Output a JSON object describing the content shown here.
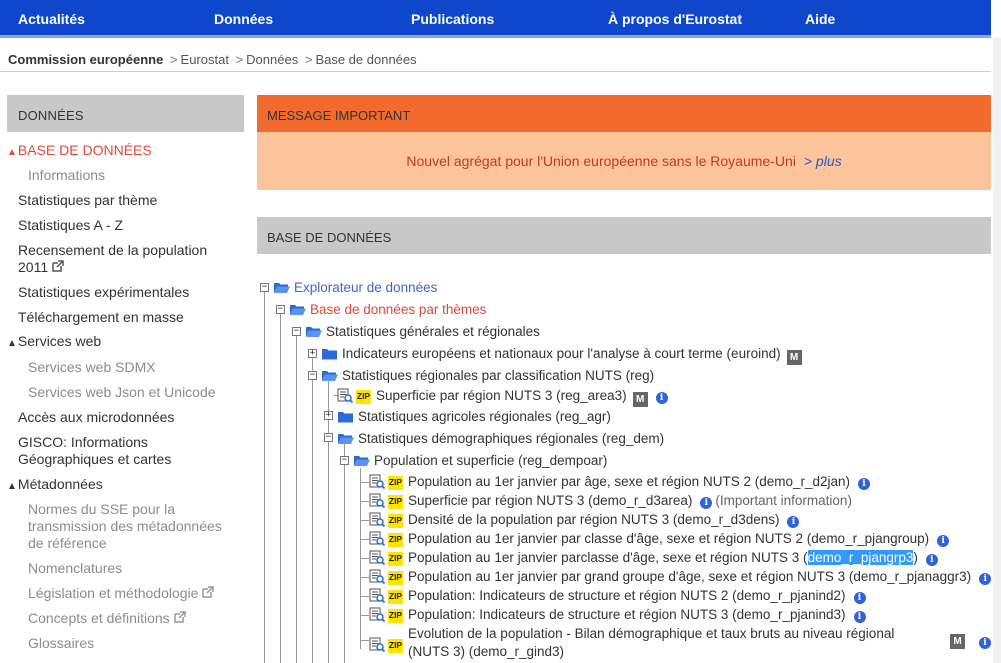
{
  "nav": {
    "items": [
      "Actualités",
      "Données",
      "Publications",
      "À propos d'Eurostat",
      "Aide"
    ]
  },
  "breadcrumb": {
    "home": "Commission européenne",
    "items": [
      "Eurostat",
      "Données",
      "Base de données"
    ]
  },
  "sidebar": {
    "title": "DONNÉES",
    "items": {
      "base": "BASE DE DONNÉES",
      "informations": "Informations",
      "stat_theme": "Statistiques par thème",
      "stat_az": "Statistiques A - Z",
      "recensement_1": "Recensement de la population",
      "recensement_2": "2011",
      "experimentales": "Statistiques expérimentales",
      "telechargement": "Téléchargement en masse",
      "services_web": "Services web",
      "sdmx": "Services web SDMX",
      "json": "Services web Json et Unicode",
      "microdonnees": "Accès aux microdonnées",
      "gisco_1": "GISCO: Informations",
      "gisco_2": "Géographiques et cartes",
      "metadonnees": "Métadonnées",
      "normes_1": "Normes du SSE pour la",
      "normes_2": "transmission des métadonnées",
      "normes_3": "de référence",
      "nomenclatures": "Nomenclatures",
      "legislation": "Législation et méthodologie",
      "concepts": "Concepts et définitions",
      "glossaires": "Glossaires"
    }
  },
  "message": {
    "header": "MESSAGE IMPORTANT",
    "text": "Nouvel agrégat pour l'Union européenne sans le Royaume-Uni",
    "more": "> plus"
  },
  "database": {
    "header": "BASE DE DONNÉES",
    "tree": {
      "explorer": "Explorateur de données",
      "by_theme": "Base de données par thèmes",
      "general": "Statistiques générales et régionales",
      "euroind": "Indicateurs européens et nationaux pour l'analyse à court terme (euroind)",
      "reg": "Statistiques régionales par classification NUTS (reg)",
      "reg_area3": "Superficie par région NUTS 3 (reg_area3)",
      "reg_agr": "Statistiques agricoles régionales (reg_agr)",
      "reg_dem": "Statistiques démographiques régionales (reg_dem)",
      "reg_dempoar": "Population et superficie (reg_dempoar)",
      "d2jan": "Population au 1er janvier par âge, sexe et région NUTS 2 (demo_r_d2jan)",
      "d3area": "Superficie par région NUTS 3 (demo_r_d3area)",
      "d3area_note": "(Important information)",
      "d3dens": "Densité de la population par région NUTS 3 (demo_r_d3dens)",
      "pjangroup": "Population au 1er janvier par classe d'âge, sexe et région NUTS 2 (demo_r_pjangroup)",
      "pjangrp3_pre": "Population au 1er janvier parclasse d'âge, sexe et région NUTS 3 (",
      "pjangrp3_hl": "demo_r_pjangrp3",
      "pjangrp3_post": ")",
      "pjanaggr3": "Population au 1er janvier par grand groupe d'âge, sexe et région NUTS 3 (demo_r_pjanaggr3)",
      "pjanind2": "Population: Indicateurs de structure et région NUTS 2 (demo_r_pjanind2)",
      "pjanind3": "Population: Indicateurs de structure et région NUTS 3 (demo_r_pjanind3)",
      "gind3_1": "Evolution de la population - Bilan démographique et taux bruts au niveau régional",
      "gind3_2": "(NUTS 3) (demo_r_gind3)"
    },
    "zip_label": "ZIP",
    "m_label": "M",
    "info_label": "i"
  },
  "colors": {
    "nav_bg": "#0e47cb",
    "accent_red": "#e0483a",
    "message_header": "#f26b2d",
    "message_body": "#fbc49b",
    "link_blue": "#3b68c8",
    "section_gray": "#c8c8c8",
    "zip_yellow": "#ffe400"
  }
}
